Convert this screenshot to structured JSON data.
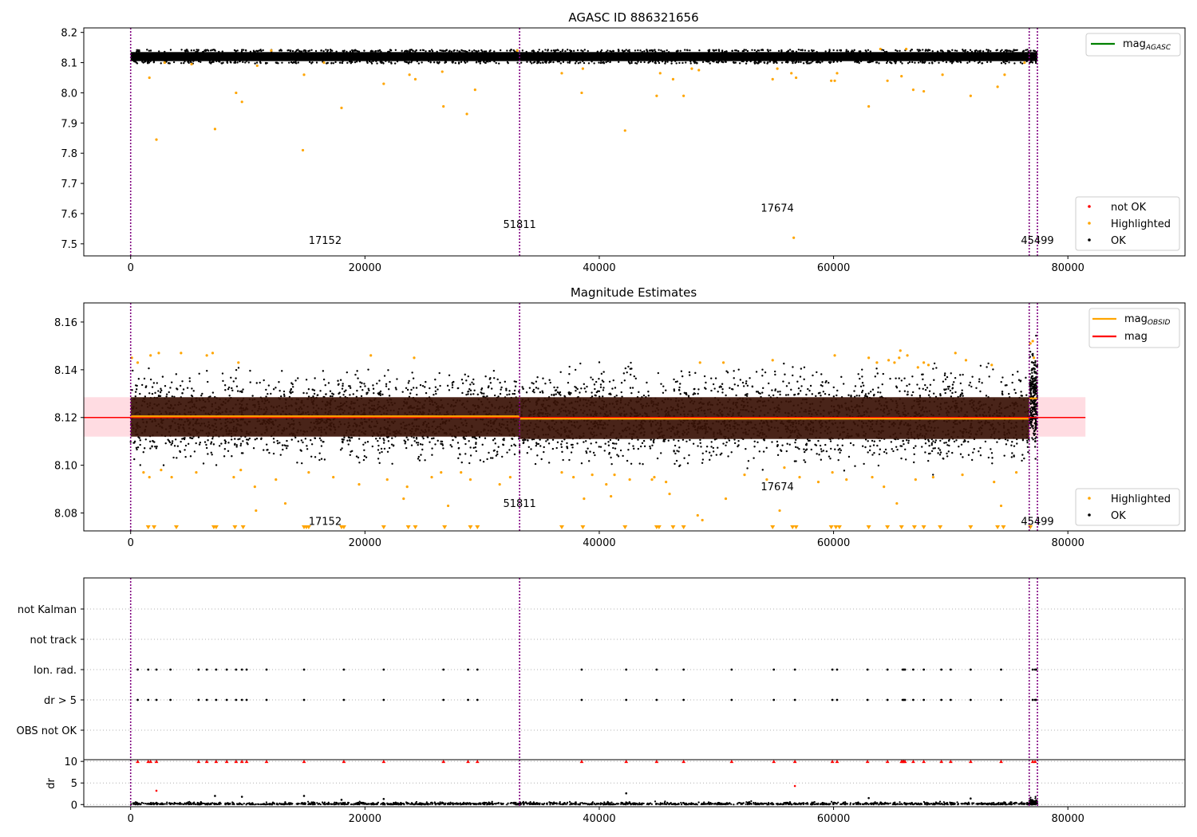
{
  "figure": {
    "panel1_title": "AGASC ID 886321656",
    "panel2_title": "Magnitude Estimates"
  },
  "colors": {
    "ok": "#000000",
    "highlighted": "#ffa500",
    "not_ok": "#ff0000",
    "obsid_line": "#800080",
    "mag_agasc": "#008000",
    "mag_obsid": "#ffa500",
    "mag": "#ff0000",
    "band_fill": "#ffc0cb",
    "obs_band": "#3a1408"
  },
  "chart_data": [
    {
      "id": "agasc",
      "type": "scatter",
      "title": "AGASC ID 886321656",
      "xlim": [
        -4000,
        90000
      ],
      "ylim": [
        7.46,
        8.215
      ],
      "xticks": [
        0,
        20000,
        40000,
        60000,
        80000
      ],
      "xticklabels": [
        "0",
        "20000",
        "40000",
        "60000",
        "80000"
      ],
      "yticks": [
        7.5,
        7.6,
        7.7,
        7.8,
        7.9,
        8.0,
        8.1,
        8.2
      ],
      "yticklabels": [
        "7.5",
        "7.6",
        "7.7",
        "7.8",
        "7.9",
        "8.0",
        "8.1",
        "8.2"
      ],
      "grid": false,
      "obsid_boundaries": [
        0,
        33200,
        76700,
        77400
      ],
      "obsid_labels": [
        {
          "text": "17152",
          "x": 16600,
          "y": 7.5
        },
        {
          "text": "51811",
          "x": 33200,
          "y": 7.552
        },
        {
          "text": "17674",
          "x": 55200,
          "y": 7.606
        },
        {
          "text": "45499",
          "x": 77400,
          "y": 7.5
        }
      ],
      "ok_band": {
        "x": [
          0,
          77400
        ],
        "y": [
          8.105,
          8.135
        ]
      },
      "highlighted_points": [
        [
          1600,
          8.05
        ],
        [
          2200,
          7.845
        ],
        [
          9000,
          8.0
        ],
        [
          9500,
          7.97
        ],
        [
          7200,
          7.88
        ],
        [
          14700,
          7.81
        ],
        [
          18000,
          7.95
        ],
        [
          14800,
          8.06
        ],
        [
          10800,
          8.09
        ],
        [
          21600,
          8.03
        ],
        [
          23800,
          8.06
        ],
        [
          24300,
          8.045
        ],
        [
          26700,
          7.955
        ],
        [
          26600,
          8.07
        ],
        [
          28700,
          7.93
        ],
        [
          29400,
          8.01
        ],
        [
          2900,
          8.1
        ],
        [
          5200,
          8.095
        ],
        [
          16500,
          8.1
        ],
        [
          36800,
          8.065
        ],
        [
          38500,
          8.0
        ],
        [
          38600,
          8.08
        ],
        [
          42200,
          7.875
        ],
        [
          44900,
          7.99
        ],
        [
          45200,
          8.065
        ],
        [
          46300,
          8.045
        ],
        [
          47200,
          7.99
        ],
        [
          47900,
          8.08
        ],
        [
          48500,
          8.075
        ],
        [
          54800,
          8.045
        ],
        [
          55200,
          8.08
        ],
        [
          56600,
          7.52
        ],
        [
          56800,
          8.05
        ],
        [
          56400,
          8.065
        ],
        [
          59800,
          8.04
        ],
        [
          60300,
          8.065
        ],
        [
          60100,
          8.04
        ],
        [
          63000,
          7.955
        ],
        [
          64600,
          8.04
        ],
        [
          65800,
          8.055
        ],
        [
          66800,
          8.01
        ],
        [
          67700,
          8.005
        ],
        [
          69300,
          8.06
        ],
        [
          71700,
          7.99
        ],
        [
          74000,
          8.02
        ],
        [
          74600,
          8.06
        ],
        [
          76300,
          8.1
        ],
        [
          64000,
          8.145
        ],
        [
          66200,
          8.145
        ],
        [
          12000,
          8.14
        ],
        [
          33000,
          8.14
        ]
      ],
      "legend_lines": [
        {
          "label": "mag",
          "sub": "AGASC",
          "color": "#008000"
        }
      ],
      "legend_markers": [
        {
          "label": "not OK",
          "color": "#ff0000"
        },
        {
          "label": "Highlighted",
          "color": "#ffa500"
        },
        {
          "label": "OK",
          "color": "#000000"
        }
      ]
    },
    {
      "id": "estimates",
      "type": "scatter",
      "title": "Magnitude Estimates",
      "xlim": [
        -4000,
        90000
      ],
      "ylim": [
        8.0725,
        8.168
      ],
      "xticks": [
        0,
        20000,
        40000,
        60000,
        80000
      ],
      "xticklabels": [
        "0",
        "20000",
        "40000",
        "60000",
        "80000"
      ],
      "yticks": [
        8.08,
        8.1,
        8.12,
        8.14,
        8.16
      ],
      "yticklabels": [
        "8.08",
        "8.10",
        "8.12",
        "8.14",
        "8.16"
      ],
      "grid": false,
      "obsid_boundaries": [
        0,
        33200,
        76700,
        77400
      ],
      "obsid_labels": [
        {
          "text": "17152",
          "x": 16600,
          "y": 8.075
        },
        {
          "text": "51811",
          "x": 33200,
          "y": 8.0825
        },
        {
          "text": "17674",
          "x": 55200,
          "y": 8.0895
        },
        {
          "text": "45499",
          "x": 77400,
          "y": 8.075
        }
      ],
      "mag": 8.12,
      "mag_band": {
        "x": [
          -4000,
          81500
        ],
        "y": [
          8.112,
          8.1285
        ]
      },
      "mag_obsid": [
        {
          "x0": 0,
          "x1": 33200,
          "value": 8.1205
        },
        {
          "x0": 33200,
          "x1": 76700,
          "value": 8.1195
        },
        {
          "x0": 76700,
          "x1": 77400,
          "value": 8.128
        }
      ],
      "obs_bands": [
        {
          "x0": 0,
          "x1": 33200,
          "y0": 8.112,
          "y1": 8.1285
        },
        {
          "x0": 33200,
          "x1": 76700,
          "y0": 8.111,
          "y1": 8.1285
        }
      ],
      "ok_spread": [
        {
          "x0": 0,
          "x1": 33200,
          "y0": 8.1,
          "y1": 8.142
        },
        {
          "x0": 33200,
          "x1": 76700,
          "y0": 8.096,
          "y1": 8.144
        }
      ],
      "highlighted_points": [
        [
          100,
          8.145
        ],
        [
          600,
          8.143
        ],
        [
          1700,
          8.146
        ],
        [
          2400,
          8.147
        ],
        [
          4300,
          8.147
        ],
        [
          6500,
          8.146
        ],
        [
          7000,
          8.147
        ],
        [
          9200,
          8.143
        ],
        [
          20500,
          8.146
        ],
        [
          24200,
          8.145
        ],
        [
          1100,
          8.097
        ],
        [
          1600,
          8.095
        ],
        [
          2600,
          8.098
        ],
        [
          3500,
          8.095
        ],
        [
          5600,
          8.097
        ],
        [
          8800,
          8.095
        ],
        [
          9400,
          8.098
        ],
        [
          10600,
          8.091
        ],
        [
          10700,
          8.081
        ],
        [
          12400,
          8.094
        ],
        [
          13200,
          8.084
        ],
        [
          15200,
          8.097
        ],
        [
          17300,
          8.095
        ],
        [
          19500,
          8.092
        ],
        [
          21900,
          8.094
        ],
        [
          23300,
          8.086
        ],
        [
          23600,
          8.091
        ],
        [
          25700,
          8.095
        ],
        [
          26500,
          8.097
        ],
        [
          27100,
          8.083
        ],
        [
          28200,
          8.097
        ],
        [
          29000,
          8.094
        ],
        [
          31500,
          8.092
        ],
        [
          32400,
          8.095
        ],
        [
          36800,
          8.097
        ],
        [
          37800,
          8.095
        ],
        [
          38700,
          8.086
        ],
        [
          39400,
          8.096
        ],
        [
          40600,
          8.092
        ],
        [
          41000,
          8.087
        ],
        [
          41300,
          8.096
        ],
        [
          42600,
          8.094
        ],
        [
          44700,
          8.095
        ],
        [
          45700,
          8.093
        ],
        [
          46000,
          8.088
        ],
        [
          48400,
          8.079
        ],
        [
          48800,
          8.077
        ],
        [
          50800,
          8.086
        ],
        [
          52400,
          8.096
        ],
        [
          54300,
          8.094
        ],
        [
          55400,
          8.081
        ],
        [
          55800,
          8.099
        ],
        [
          57100,
          8.095
        ],
        [
          58700,
          8.093
        ],
        [
          59900,
          8.097
        ],
        [
          61100,
          8.094
        ],
        [
          63300,
          8.095
        ],
        [
          64300,
          8.091
        ],
        [
          65400,
          8.084
        ],
        [
          67000,
          8.094
        ],
        [
          68500,
          8.095
        ],
        [
          71000,
          8.096
        ],
        [
          73700,
          8.093
        ],
        [
          74300,
          8.083
        ],
        [
          75600,
          8.097
        ],
        [
          44500,
          8.094
        ],
        [
          60100,
          8.146
        ],
        [
          63000,
          8.145
        ],
        [
          64700,
          8.144
        ],
        [
          65200,
          8.143
        ],
        [
          65700,
          8.148
        ],
        [
          66300,
          8.146
        ],
        [
          67200,
          8.141
        ],
        [
          67700,
          8.143
        ],
        [
          68100,
          8.142
        ],
        [
          70400,
          8.147
        ],
        [
          71300,
          8.144
        ],
        [
          76800,
          8.151
        ],
        [
          77000,
          8.152
        ],
        [
          77100,
          8.145
        ],
        [
          50600,
          8.143
        ],
        [
          54800,
          8.144
        ],
        [
          48600,
          8.143
        ],
        [
          63700,
          8.143
        ],
        [
          65600,
          8.145
        ],
        [
          73500,
          8.142
        ]
      ],
      "clipped_markers": [
        1500,
        2000,
        3900,
        7100,
        7300,
        8900,
        9600,
        14800,
        15000,
        15200,
        18000,
        18200,
        21600,
        23700,
        24300,
        26800,
        29000,
        29600,
        36800,
        38600,
        42200,
        44900,
        45100,
        46300,
        47200,
        54800,
        56500,
        56800,
        59800,
        60200,
        60500,
        63000,
        64600,
        65800,
        66900,
        67700,
        69100,
        71700,
        74000,
        74500,
        76800
      ],
      "legend_lines": [
        {
          "label": "mag",
          "sub": "OBSID",
          "color": "#ffa500"
        },
        {
          "label": "mag",
          "sub": "",
          "color": "#ff0000"
        }
      ],
      "legend_markers": [
        {
          "label": "Highlighted",
          "color": "#ffa500"
        },
        {
          "label": "OK",
          "color": "#000000"
        }
      ]
    },
    {
      "id": "flags",
      "type": "scatter",
      "xlim": [
        -4000,
        90000
      ],
      "yticklabels": [
        "not Kalman",
        "not track",
        "Ion. rad.",
        "dr > 5",
        "OBS not OK"
      ],
      "obsid_boundaries": [
        0,
        33200,
        76700,
        77400
      ],
      "flag_ion_rad": [
        600,
        1500,
        2200,
        3400,
        5800,
        6500,
        7300,
        8200,
        9000,
        9500,
        9900,
        11600,
        14800,
        18200,
        21600,
        26700,
        28800,
        29600,
        38500,
        42300,
        44900,
        47200,
        51300,
        54900,
        56700,
        59900,
        60300,
        62900,
        64600,
        65900,
        66000,
        66100,
        66800,
        67700,
        69200,
        70000,
        71700,
        74300,
        77000,
        77200,
        77300
      ],
      "flag_dr5": [
        600,
        1500,
        2200,
        3400,
        5800,
        6500,
        7300,
        8200,
        9000,
        9500,
        9900,
        11600,
        14800,
        18200,
        21600,
        26700,
        28800,
        29600,
        38500,
        42300,
        44900,
        47200,
        51300,
        54900,
        56700,
        59900,
        60300,
        62900,
        64600,
        65900,
        66000,
        66100,
        66800,
        67700,
        69200,
        70000,
        71700,
        74300,
        77000,
        77200,
        77300
      ]
    },
    {
      "id": "dr",
      "type": "scatter",
      "ylabel": "dr",
      "xlim": [
        -4000,
        90000
      ],
      "ylim": [
        -0.5,
        10.4
      ],
      "xticks": [
        0,
        20000,
        40000,
        60000,
        80000
      ],
      "xticklabels": [
        "0",
        "20000",
        "40000",
        "60000",
        "80000"
      ],
      "yticks": [
        0,
        5,
        10
      ],
      "yticklabels": [
        "0",
        "5",
        "10"
      ],
      "grid": true,
      "obsid_boundaries": [
        0,
        33200,
        76700,
        77400
      ],
      "clipped_red": [
        600,
        1500,
        1700,
        2200,
        5800,
        6500,
        7300,
        8200,
        9000,
        9500,
        9900,
        11600,
        14800,
        18200,
        21600,
        26700,
        28800,
        29600,
        38500,
        42300,
        44900,
        47200,
        51300,
        54900,
        56700,
        59900,
        60300,
        62900,
        64600,
        65800,
        65900,
        66000,
        66100,
        66800,
        67700,
        69200,
        70000,
        71700,
        74300,
        77000,
        77200
      ],
      "scattered": [
        [
          2200,
          3.2,
          "#ff0000"
        ],
        [
          7200,
          2.0,
          "#000000"
        ],
        [
          9500,
          1.8,
          "#000000"
        ],
        [
          14800,
          2.0,
          "#000000"
        ],
        [
          42300,
          2.6,
          "#000000"
        ],
        [
          56700,
          4.3,
          "#ff0000"
        ],
        [
          21600,
          1.3,
          "#000000"
        ],
        [
          63000,
          1.5,
          "#000000"
        ],
        [
          71700,
          1.4,
          "#000000"
        ],
        [
          18000,
          1.1,
          "#000000"
        ]
      ]
    }
  ]
}
